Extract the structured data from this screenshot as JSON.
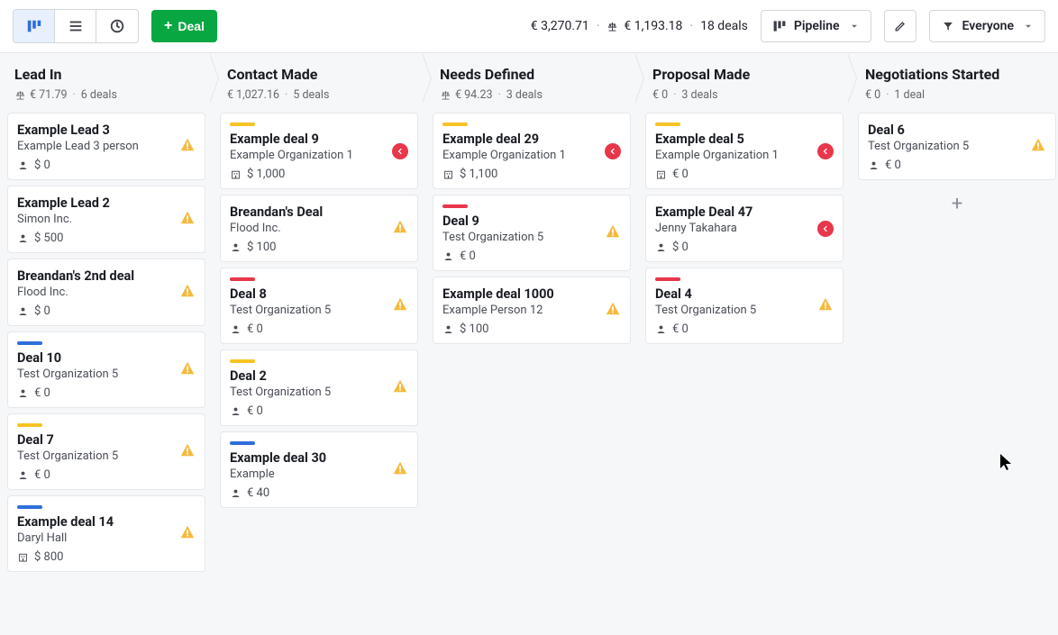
{
  "toolbar": {
    "deal_button": "Deal",
    "total_amount": "€ 3,270.71",
    "weighted_amount": "€ 1,193.18",
    "deals_count": "18 deals",
    "pipeline_label": "Pipeline",
    "owner_label": "Everyone"
  },
  "columns": [
    {
      "title": "Lead In",
      "show_scale": true,
      "amount": "€ 71.79",
      "count": "6 deals",
      "deals": [
        {
          "stripe": null,
          "title": "Example Lead 3",
          "org": "Example Lead 3 person",
          "amount_icon": "person",
          "amount": "$ 0",
          "status": "warn"
        },
        {
          "stripe": null,
          "title": "Example Lead 2",
          "org": "Simon Inc.",
          "amount_icon": "person",
          "amount": "$ 500",
          "status": "warn"
        },
        {
          "stripe": null,
          "title": "Breandan's 2nd deal",
          "org": "Flood Inc.",
          "amount_icon": "person",
          "amount": "$ 0",
          "status": "warn"
        },
        {
          "stripe": "blue",
          "title": "Deal 10",
          "org": "Test Organization 5",
          "amount_icon": "person",
          "amount": "€ 0",
          "status": "warn"
        },
        {
          "stripe": "yellow",
          "title": "Deal 7",
          "org": "Test Organization 5",
          "amount_icon": "person",
          "amount": "€ 0",
          "status": "warn"
        },
        {
          "stripe": "blue",
          "title": "Example deal 14",
          "org": "Daryl Hall",
          "amount_icon": "org",
          "amount": "$ 800",
          "status": "warn"
        }
      ]
    },
    {
      "title": "Contact Made",
      "show_scale": false,
      "amount": "€ 1,027.16",
      "count": "5 deals",
      "deals": [
        {
          "stripe": "yellow",
          "title": "Example deal 9",
          "org": "Example Organization 1",
          "amount_icon": "org",
          "amount": "$ 1,000",
          "status": "red"
        },
        {
          "stripe": null,
          "title": "Breandan's Deal",
          "org": "Flood Inc.",
          "amount_icon": "person",
          "amount": "$ 100",
          "status": "warn"
        },
        {
          "stripe": "red",
          "title": "Deal 8",
          "org": "Test Organization 5",
          "amount_icon": "person",
          "amount": "€ 0",
          "status": "warn"
        },
        {
          "stripe": "yellow",
          "title": "Deal 2",
          "org": "Test Organization 5",
          "amount_icon": "person",
          "amount": "€ 0",
          "status": "warn"
        },
        {
          "stripe": "blue",
          "title": "Example deal 30",
          "org": "Example",
          "amount_icon": "person",
          "amount": "€ 40",
          "status": "warn"
        }
      ]
    },
    {
      "title": "Needs Defined",
      "show_scale": true,
      "amount": "€ 94.23",
      "count": "3 deals",
      "deals": [
        {
          "stripe": "yellow",
          "title": "Example deal 29",
          "org": "Example Organization 1",
          "amount_icon": "org",
          "amount": "$ 1,100",
          "status": "red"
        },
        {
          "stripe": "red",
          "title": "Deal 9",
          "org": "Test Organization 5",
          "amount_icon": "person",
          "amount": "€ 0",
          "status": "warn"
        },
        {
          "stripe": null,
          "title": "Example deal 1000",
          "org": "Example Person 12",
          "amount_icon": "person",
          "amount": "$ 100",
          "status": "warn"
        }
      ]
    },
    {
      "title": "Proposal Made",
      "show_scale": false,
      "amount": "€ 0",
      "count": "3 deals",
      "deals": [
        {
          "stripe": "yellow",
          "title": "Example deal 5",
          "org": "Example Organization 1",
          "amount_icon": "org",
          "amount": "€ 0",
          "status": "red"
        },
        {
          "stripe": null,
          "title": "Example Deal 47",
          "org": "Jenny Takahara",
          "amount_icon": "person",
          "amount": "$ 0",
          "status": "red"
        },
        {
          "stripe": "red",
          "title": "Deal 4",
          "org": "Test Organization 5",
          "amount_icon": "person",
          "amount": "€ 0",
          "status": "warn"
        }
      ]
    },
    {
      "title": "Negotiations Started",
      "show_scale": false,
      "amount": "€ 0",
      "count": "1 deal",
      "show_add": true,
      "deals": [
        {
          "stripe": null,
          "title": "Deal 6",
          "org": "Test Organization 5",
          "amount_icon": "person",
          "amount": "€ 0",
          "status": "warn"
        }
      ]
    }
  ]
}
